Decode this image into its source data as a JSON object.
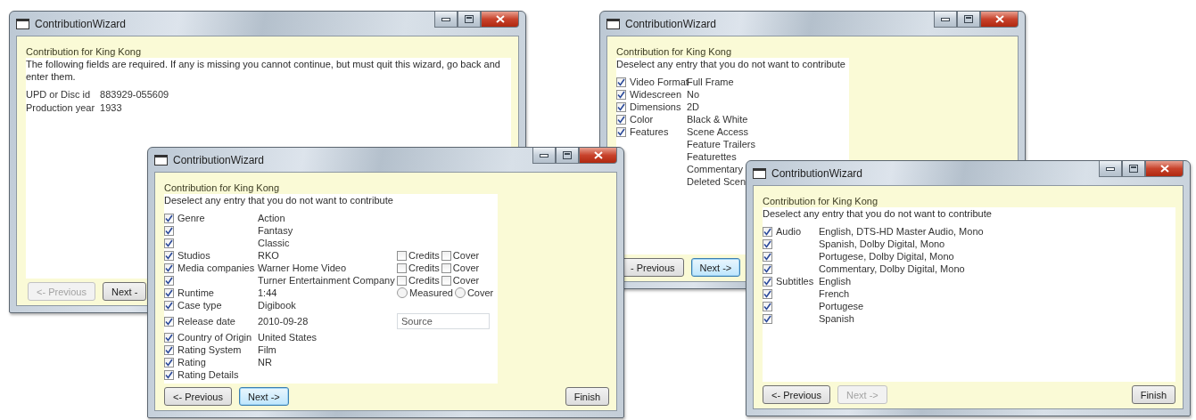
{
  "windows": [
    {
      "title": "ContributionWizard",
      "heading": "Contribution for King Kong",
      "text": "The following fields are required. If any is missing you cannot continue, but must quit this wizard, go back and enter them.",
      "fields": [
        {
          "label": "UPD or Disc id",
          "value": "883929-055609"
        },
        {
          "label": "Production year",
          "value": "1933"
        }
      ],
      "buttons": [
        {
          "kind": "previous",
          "label": "<- Previous",
          "disabled": true,
          "focused": false
        },
        {
          "kind": "next",
          "label": "Next -",
          "disabled": false,
          "focused": false
        }
      ]
    },
    {
      "title": "ContributionWizard",
      "heading": "Contribution for King Kong",
      "text": "Deselect any entry that you do not want to contribute",
      "rows": [
        {
          "checked": true,
          "label": "Video Format",
          "value": "Full Frame"
        },
        {
          "checked": true,
          "label": "Widescreen",
          "value": "No"
        },
        {
          "checked": true,
          "label": "Dimensions",
          "value": "2D"
        },
        {
          "checked": true,
          "label": "Color",
          "value": "Black & White"
        },
        {
          "checked": true,
          "label": "Features",
          "value": "Scene Access"
        },
        {
          "value": "Feature Trailers"
        },
        {
          "value": "Featurettes"
        },
        {
          "value": "Commentary"
        },
        {
          "value": "Deleted Scen"
        }
      ],
      "buttons": [
        {
          "kind": "previous",
          "label": "- Previous",
          "disabled": false,
          "focused": false
        },
        {
          "kind": "next",
          "label": "Next ->",
          "disabled": false,
          "focused": true
        }
      ]
    },
    {
      "title": "ContributionWizard",
      "heading": "Contribution for King Kong",
      "text": "Deselect any entry that you do not want to contribute",
      "rows": [
        {
          "checked": true,
          "label": "Genre",
          "value": "Action"
        },
        {
          "checked": true,
          "value": "Fantasy"
        },
        {
          "checked": true,
          "value": "Classic"
        },
        {
          "checked": true,
          "label": "Studios",
          "value": "RKO",
          "options": [
            {
              "kind": "checkbox",
              "label": "Credits",
              "checked": false
            },
            {
              "kind": "checkbox",
              "label": "Cover",
              "checked": false
            }
          ]
        },
        {
          "checked": true,
          "label": "Media companies",
          "value": "Warner Home Video",
          "options": [
            {
              "kind": "checkbox",
              "label": "Credits",
              "checked": false
            },
            {
              "kind": "checkbox",
              "label": "Cover",
              "checked": false
            }
          ]
        },
        {
          "checked": true,
          "value": "Turner Entertainment Company",
          "options": [
            {
              "kind": "checkbox",
              "label": "Credits",
              "checked": false
            },
            {
              "kind": "checkbox",
              "label": "Cover",
              "checked": false
            }
          ]
        },
        {
          "checked": true,
          "label": "Runtime",
          "value": "1:44",
          "options": [
            {
              "kind": "radio",
              "label": "Measured",
              "selected": false
            },
            {
              "kind": "radio",
              "label": "Cover",
              "selected": false
            }
          ]
        },
        {
          "checked": true,
          "label": "Case type",
          "value": "Digibook"
        },
        {
          "checked": true,
          "label": "Release date",
          "value": "2010-09-28",
          "field": {
            "placeholder": "Source"
          }
        },
        {
          "checked": true,
          "label": "Country of Origin",
          "value": "United States"
        },
        {
          "checked": true,
          "label": "Rating System",
          "value": "Film"
        },
        {
          "checked": true,
          "label": "Rating",
          "value": "NR"
        },
        {
          "checked": true,
          "label": "Rating Details"
        }
      ],
      "buttons": [
        {
          "kind": "previous",
          "label": "<- Previous",
          "disabled": false,
          "focused": false
        },
        {
          "kind": "next",
          "label": "Next ->",
          "disabled": false,
          "focused": true
        },
        {
          "kind": "finish",
          "label": "Finish",
          "disabled": false,
          "focused": false
        }
      ]
    },
    {
      "title": "ContributionWizard",
      "heading": "Contribution for King Kong",
      "text": "Deselect any entry that you do not want to contribute",
      "rows": [
        {
          "checked": true,
          "label": "Audio",
          "value": "English, DTS-HD Master Audio, Mono"
        },
        {
          "checked": true,
          "value": "Spanish, Dolby Digital, Mono"
        },
        {
          "checked": true,
          "value": "Portugese, Dolby Digital, Mono"
        },
        {
          "checked": true,
          "value": "Commentary, Dolby Digital, Mono"
        },
        {
          "checked": true,
          "label": "Subtitles",
          "value": "English"
        },
        {
          "checked": true,
          "value": "French"
        },
        {
          "checked": true,
          "value": "Portugese"
        },
        {
          "checked": true,
          "value": "Spanish"
        }
      ],
      "buttons": [
        {
          "kind": "previous",
          "label": "<- Previous",
          "disabled": false,
          "focused": false
        },
        {
          "kind": "next",
          "label": "Next ->",
          "disabled": true,
          "focused": false
        },
        {
          "kind": "finish",
          "label": "Finish",
          "disabled": false,
          "focused": false
        }
      ]
    }
  ]
}
